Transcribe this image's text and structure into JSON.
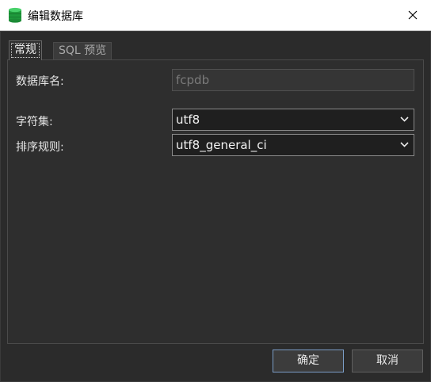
{
  "window": {
    "title": "编辑数据库",
    "icon": "database-icon",
    "close_icon": "close-icon"
  },
  "tabs": [
    {
      "label": "常规",
      "active": true
    },
    {
      "label": "SQL 预览",
      "active": false
    }
  ],
  "form": {
    "db_name_label": "数据库名:",
    "db_name_value": "fcpdb",
    "charset_label": "字符集:",
    "charset_value": "utf8",
    "collation_label": "排序规则:",
    "collation_value": "utf8_general_ci"
  },
  "buttons": {
    "ok_label": "确定",
    "cancel_label": "取消"
  },
  "colors": {
    "background": "#2b2b2b",
    "titlebar": "#ffffff",
    "icon_green": "#2fb34a",
    "ok_border": "#7a9cc6"
  }
}
